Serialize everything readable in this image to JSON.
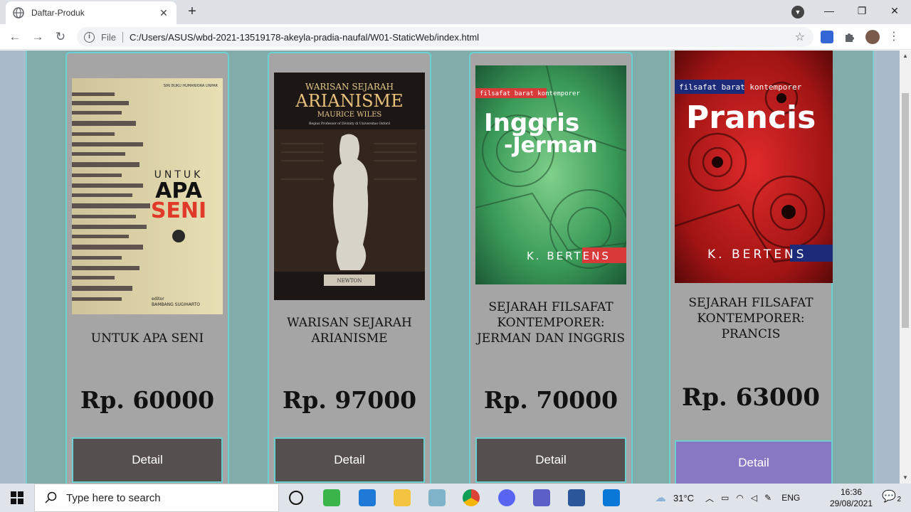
{
  "browser": {
    "tab_title": "Daftar-Produk",
    "address_scheme": "File",
    "address_url": "C:/Users/ASUS/wbd-2021-13519178-akeyla-pradia-naufal/W01-StaticWeb/index.html"
  },
  "products": [
    {
      "name": "UNTUK APA SENI",
      "price": "Rp. 60000",
      "button": "Detail",
      "cover": {
        "line1": "UNTUK",
        "line2": "APA",
        "line3": "SENI",
        "top_text": "SIRI BUKU HUMANIORA UNPAR",
        "editor": "editor",
        "editor_name": "BAMBANG SUGIHARTO"
      }
    },
    {
      "name": "WARISAN SEJARAH ARIANISME",
      "price": "Rp. 97000",
      "button": "Detail",
      "cover": {
        "line1": "WARISAN SEJARAH",
        "line2": "ARIANISME",
        "line3": "MAURICE WILES",
        "subtitle": "Regius Professor of Divinity di Universitas Oxford",
        "plaque": "NEWTON"
      }
    },
    {
      "name": "SEJARAH FILSAFAT KONTEMPORER: JERMAN DAN INGGRIS",
      "price": "Rp. 70000",
      "button": "Detail",
      "cover": {
        "series": "filsafat barat kontemporer",
        "line1": "Inggris",
        "line2": "-Jerman",
        "author": "K. BERTENS"
      }
    },
    {
      "name": "SEJARAH FILSAFAT KONTEMPORER: PRANCIS",
      "price": "Rp. 63000",
      "button": "Detail",
      "cover": {
        "series": "filsafat barat kontemporer",
        "line1": "Prancis",
        "author": "K. BERTENS"
      }
    }
  ],
  "taskbar": {
    "search_placeholder": "Type here to search",
    "weather": "31°C",
    "language": "ENG",
    "time": "16:36",
    "date": "29/08/2021",
    "notifications": "2"
  }
}
